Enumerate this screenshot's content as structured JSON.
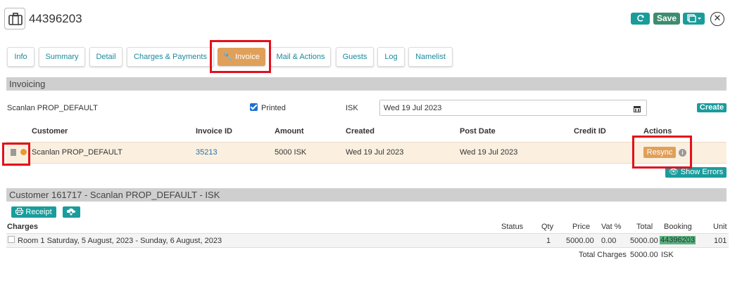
{
  "header": {
    "booking_number": "44396203",
    "save_label": "Save",
    "close_glyph": "✕"
  },
  "tabs": [
    {
      "label": "Info"
    },
    {
      "label": "Summary"
    },
    {
      "label": "Detail"
    },
    {
      "label": "Charges & Payments"
    },
    {
      "label": "Invoice",
      "active": true
    },
    {
      "label": "Mail & Actions"
    },
    {
      "label": "Guests"
    },
    {
      "label": "Log"
    },
    {
      "label": "Namelist"
    }
  ],
  "invoicing": {
    "title": "Invoicing",
    "customer_name": "Scanlan PROP_DEFAULT",
    "printed_label": "Printed",
    "printed_checked": true,
    "currency": "ISK",
    "date_value": "Wed 19 Jul 2023",
    "create_label": "Create",
    "columns": {
      "customer": "Customer",
      "invoice_id": "Invoice ID",
      "amount": "Amount",
      "created": "Created",
      "post_date": "Post Date",
      "credit_id": "Credit ID",
      "actions": "Actions"
    },
    "row": {
      "customer": "Scanlan PROP_DEFAULT",
      "invoice_id": "35213",
      "amount": "5000 ISK",
      "created": "Wed 19 Jul 2023",
      "post_date": "Wed 19 Jul 2023",
      "credit_id": "",
      "resync_label": "Resync"
    },
    "show_errors_label": "Show Errors"
  },
  "customer_section": {
    "title": "Customer 161717 - Scanlan PROP_DEFAULT - ISK",
    "receipt_label": "Receipt",
    "charges_columns": {
      "charges": "Charges",
      "status": "Status",
      "qty": "Qty",
      "price": "Price",
      "vat": "Vat %",
      "total": "Total",
      "booking": "Booking",
      "unit": "Unit"
    },
    "charge_row": {
      "description": "Room 1 Saturday, 5 August, 2023 - Sunday, 6 August, 2023",
      "status": "",
      "qty": "1",
      "price": "5000.00",
      "vat": "0.00",
      "total": "5000.00",
      "booking": "44396203",
      "unit": "101"
    },
    "total_charges_label": "Total Charges",
    "total_charges_value": "5000.00",
    "total_charges_currency": "ISK"
  },
  "colors": {
    "teal": "#1a9c9c",
    "orange": "#e0a05a",
    "highlight_red": "#e3101b",
    "row_bg": "#fbf0df"
  }
}
